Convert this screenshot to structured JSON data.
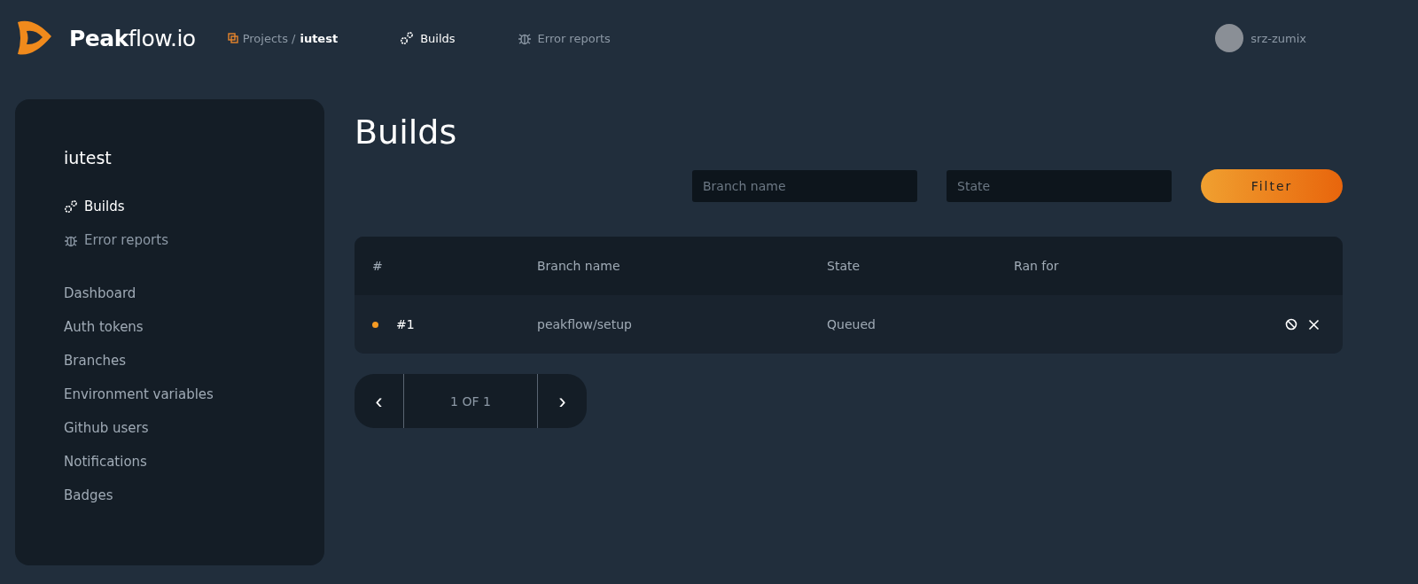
{
  "brand": "**Peak**flow.io",
  "breadcrumb": {
    "root": "Projects /",
    "current": "iutest"
  },
  "nav": [
    {
      "label": "Builds",
      "kind": "builds",
      "selected": true
    },
    {
      "label": "Error reports",
      "kind": "errors",
      "selected": false
    }
  ],
  "user": {
    "name": "srz-zumix"
  },
  "sidebar": {
    "title": "iutest",
    "sections": [
      {
        "label": "Builds",
        "kind": "builds",
        "selected": true
      },
      {
        "label": "Error reports",
        "kind": "errors",
        "selected": false
      }
    ],
    "items": [
      "Dashboard",
      "Auth tokens",
      "Branches",
      "Environment variables",
      "Github users",
      "Notifications",
      "Badges"
    ]
  },
  "page_title": "Builds",
  "filters": {
    "branch": {
      "placeholder": "Branch name"
    },
    "state": {
      "placeholder": "State"
    },
    "button": "Filter"
  },
  "table": {
    "columns": [
      "#",
      "Branch name",
      "State",
      "Ran for"
    ],
    "rows": [
      {
        "number": "#1",
        "branch": "peakflow/setup",
        "state": "Queued",
        "color": "#f59a23"
      }
    ]
  },
  "pagination": {
    "prev": "‹",
    "label": "1 OF 1",
    "next": "›"
  }
}
